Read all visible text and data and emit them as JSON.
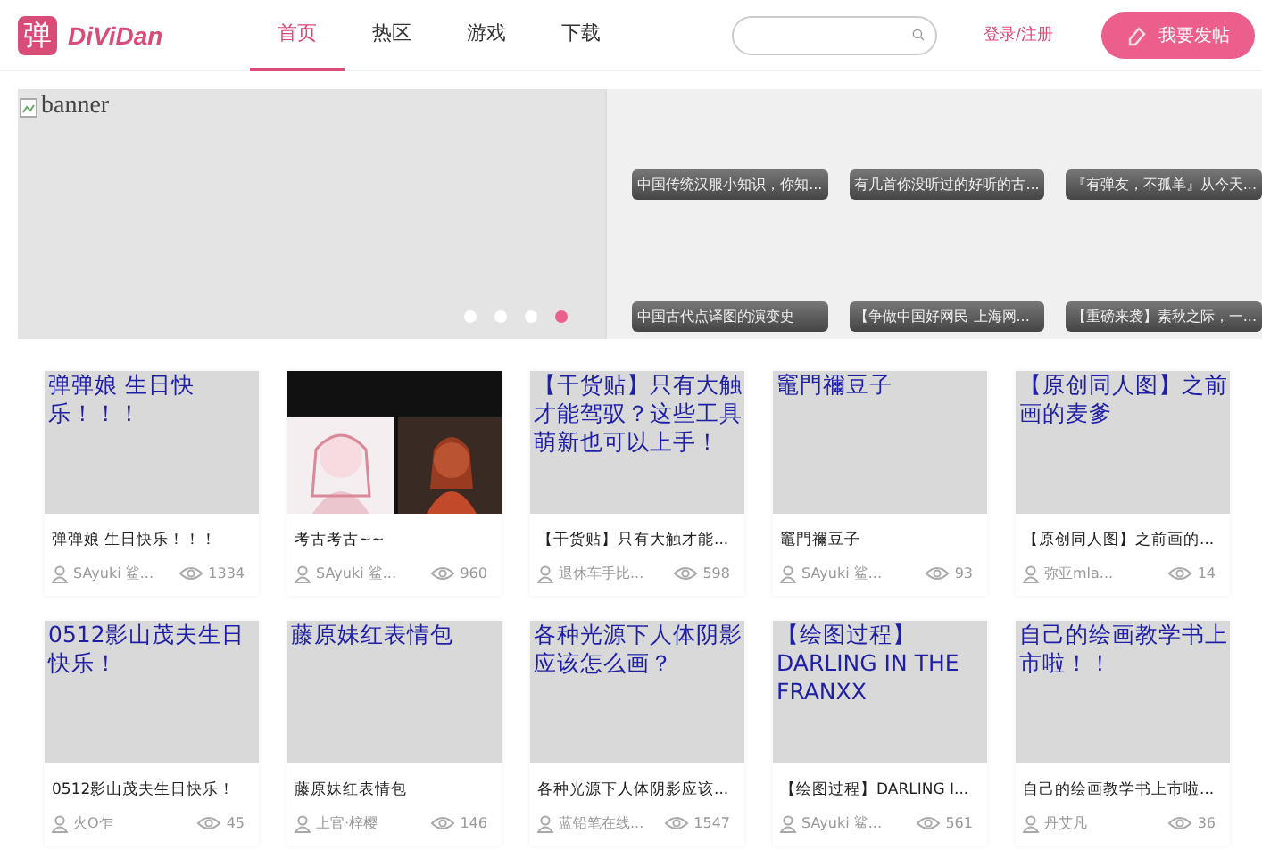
{
  "header": {
    "logo_mark": "弹",
    "logo_text": "DiViDan",
    "nav": [
      {
        "label": "首页",
        "selected": true
      },
      {
        "label": "热区",
        "selected": false
      },
      {
        "label": "游戏",
        "selected": false
      },
      {
        "label": "下载",
        "selected": false
      }
    ],
    "login": "登录/注册",
    "post_button": "我要发帖"
  },
  "banner": {
    "alt": "banner",
    "tiles": [
      {
        "caption": "中国传统汉服小知识，你知..."
      },
      {
        "caption": "有几首你没听过的好听的古..."
      },
      {
        "caption": "『有弹友，不孤单』从今天..."
      },
      {
        "caption": "中国古代点译图的演变史"
      },
      {
        "caption": "【争做中国好网民 上海网..."
      },
      {
        "caption": "【重磅来袭】素秋之际，一..."
      }
    ],
    "dots": [
      {
        "selected": false
      },
      {
        "selected": false
      },
      {
        "selected": false
      },
      {
        "selected": true
      }
    ]
  },
  "posts": [
    {
      "kind": "broken",
      "alt": "弹弹娘 生日快乐！！！",
      "title": "弹弹娘 生日快乐！！！",
      "author": "SAyuki 鲨...",
      "views": "1334"
    },
    {
      "kind": "picture",
      "title": "考古考古~~",
      "author": "SAyuki 鲨...",
      "views": "960"
    },
    {
      "kind": "broken",
      "alt": "【干货贴】只有大触才能驾驭？这些工具萌新也可以上手！",
      "title": "【干货贴】只有大触才能...",
      "author": "退休车手比...",
      "views": "598"
    },
    {
      "kind": "broken",
      "alt": "竈門禰豆子",
      "title": "竈門禰豆子",
      "author": "SAyuki 鲨...",
      "views": "93"
    },
    {
      "kind": "broken",
      "alt": "【原创同人图】之前画的麦爹",
      "title": "【原创同人图】之前画的...",
      "author": "弥亚mla...",
      "views": "14"
    },
    {
      "kind": "broken",
      "alt": "0512影山茂夫生日快乐！",
      "title": "0512影山茂夫生日快乐！",
      "author": "火O乍",
      "views": "45"
    },
    {
      "kind": "broken",
      "alt": "藤原妹红表情包",
      "title": "藤原妹红表情包",
      "author": "上官·梓樱",
      "views": "146"
    },
    {
      "kind": "broken",
      "alt": "各种光源下人体阴影应该怎么画？",
      "title": "各种光源下人体阴影应该...",
      "author": "蓝铅笔在线...",
      "views": "1547"
    },
    {
      "kind": "broken",
      "alt": "【绘图过程】DARLING IN THE FRANXX",
      "title": "【绘图过程】DARLING I...",
      "author": "SAyuki 鲨...",
      "views": "561"
    },
    {
      "kind": "broken",
      "alt": "自己的绘画教学书上市啦！！",
      "title": "自己的绘画教学书上市啦...",
      "author": "丹艾凡",
      "views": "36"
    }
  ]
}
